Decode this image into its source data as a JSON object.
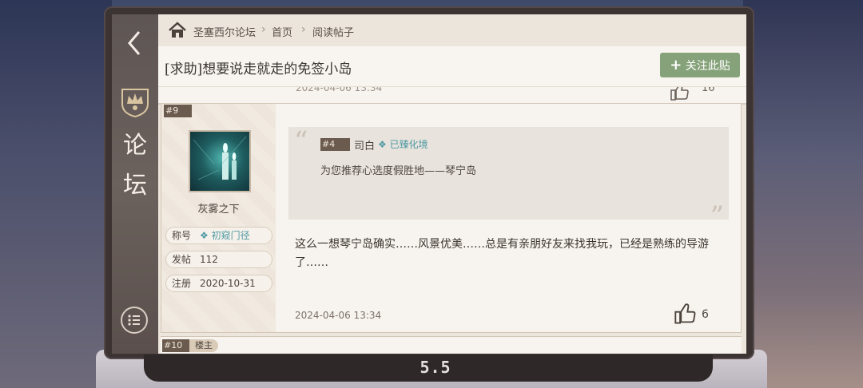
{
  "sidebar": {
    "title_line1": "论",
    "title_line2": "坛",
    "back_icon": "chevron-left-icon",
    "emblem_icon": "crown-shield-icon",
    "menu_icon": "list-menu-icon"
  },
  "breadcrumb": {
    "home_icon": "home-icon",
    "items": [
      "圣塞西尔论坛",
      "首页",
      "阅读帖子"
    ]
  },
  "thread": {
    "title": "[求助]想要说走就走的免签小岛",
    "follow_label": "关注此贴"
  },
  "previous_post": {
    "date_partial": "2024-04-06  13:34",
    "likes": "16"
  },
  "post": {
    "floor": "#9",
    "author": "灰雾之下",
    "info": [
      {
        "key": "称号",
        "value": "初窥门径"
      },
      {
        "key": "发帖",
        "value": "112"
      },
      {
        "key": "注册",
        "value": "2020-10-31"
      }
    ],
    "quote": {
      "floor": "#4",
      "author": "司白",
      "badge": "已臻化境",
      "text": "为您推荐心选度假胜地——琴宁岛"
    },
    "body": "这么一想琴宁岛确实……风景优美……总是有亲朋好友来找我玩，已经是熟练的导游了……",
    "date": "2024-04-06  13:34",
    "likes": "6"
  },
  "next_post": {
    "floor": "#10",
    "tag": "楼主"
  },
  "device": {
    "brand": "5.5"
  },
  "colors": {
    "accent_green": "#86a27a",
    "floor_tag": "#6b5b4f",
    "teal_badge": "#4f9aa4"
  }
}
